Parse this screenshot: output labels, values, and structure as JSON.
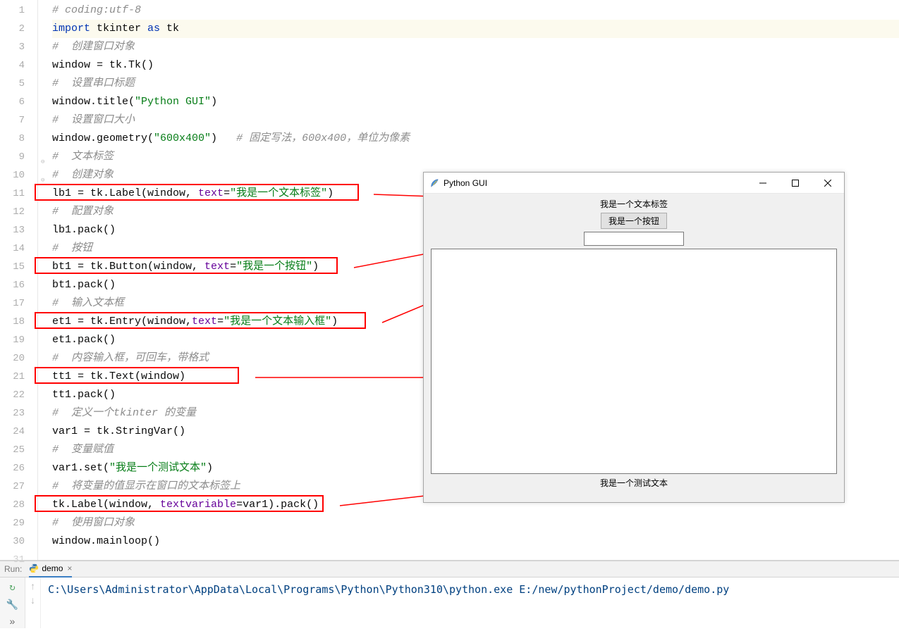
{
  "lines": {
    "1": "# coding:utf-8",
    "2a": "import",
    "2b": " tkinter ",
    "2c": "as",
    "2d": " tk",
    "3": "#  创建窗口对象",
    "4a": "window = tk.Tk()",
    "5": "#  设置串口标题",
    "6a": "window.title(",
    "6b": "\"Python GUI\"",
    "6c": ")",
    "7": "#  设置窗口大小",
    "8a": "window.geometry(",
    "8b": "\"600x400\"",
    "8c": ")   ",
    "8d": "# 固定写法，600x400，单位为像素",
    "9": "#  文本标签",
    "10": "#  创建对象",
    "11a": "lb1 = tk.Label(window, ",
    "11b": "text",
    "11c": "=",
    "11d": "\"我是一个文本标签\"",
    "11e": ")",
    "12": "#  配置对象",
    "13": "lb1.pack()",
    "14": "#  按钮",
    "15a": "bt1 = tk.Button(window, ",
    "15b": "text",
    "15c": "=",
    "15d": "\"我是一个按钮\"",
    "15e": ")",
    "16": "bt1.pack()",
    "17": "#  输入文本框",
    "18a": "et1 = tk.Entry(window,",
    "18b": "text",
    "18c": "=",
    "18d": "\"我是一个文本输入框\"",
    "18e": ")",
    "19": "et1.pack()",
    "20": "#  内容输入框，可回车，带格式",
    "21": "tt1 = tk.Text(window)",
    "22": "tt1.pack()",
    "23": "#  定义一个tkinter 的变量",
    "24": "var1 = tk.StringVar()",
    "25": "#  变量赋值",
    "26a": "var1.set(",
    "26b": "\"我是一个测试文本\"",
    "26c": ")",
    "27": "#  将变量的值显示在窗口的文本标签上",
    "28a": "tk.Label(window, ",
    "28b": "textvariable",
    "28c": "=var1).pack()",
    "29": "#  使用窗口对象",
    "30": "window.mainloop()"
  },
  "gui": {
    "title": "Python GUI",
    "label1": "我是一个文本标签",
    "button": "我是一个按钮",
    "label2": "我是一个测试文本"
  },
  "run": {
    "label": "Run:",
    "tab": "demo",
    "console": "C:\\Users\\Administrator\\AppData\\Local\\Programs\\Python\\Python310\\python.exe E:/new/pythonProject/demo/demo.py"
  }
}
